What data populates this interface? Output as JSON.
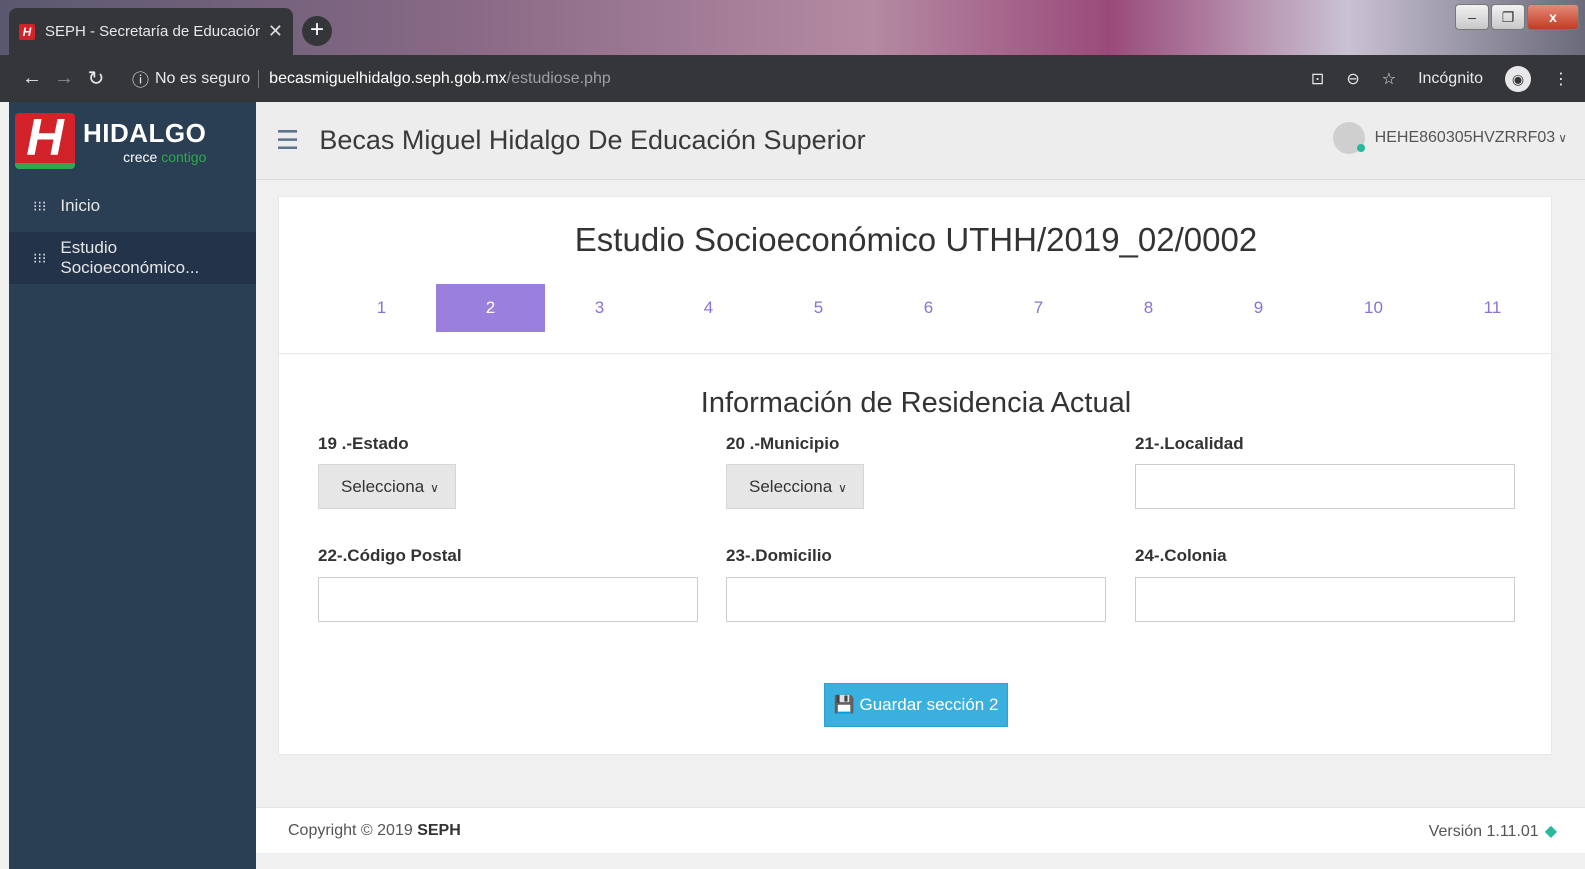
{
  "browser": {
    "tab_title": "SEPH - Secretaría de Educación P",
    "tab_favicon": "H",
    "insecure_label": "No es seguro",
    "url_host": "becasmiguelhidalgo.seph.gob.mx",
    "url_path": "/estudiose.php",
    "incognito_label": "Incógnito"
  },
  "sidebar": {
    "logo_letter": "H",
    "logo_title": "HIDALGO",
    "logo_sub_1": "crece",
    "logo_sub_2": "contigo",
    "items": [
      {
        "label": "Inicio"
      },
      {
        "label": "Estudio Socioeconómico..."
      }
    ]
  },
  "header": {
    "app_title": "Becas Miguel Hidalgo De Educación Superior",
    "user_id": "HEHE860305HVZRRF03"
  },
  "panel": {
    "title": "Estudio Socioeconómico UTHH/2019_02/0002",
    "steps": [
      "1",
      "2",
      "3",
      "4",
      "5",
      "6",
      "7",
      "8",
      "9",
      "10",
      "11"
    ],
    "active_step": "2",
    "section_title": "Información de Residencia Actual",
    "fields": {
      "estado_label": "19 .-Estado",
      "estado_value": "Selecciona",
      "municipio_label": "20 .-Municipio",
      "municipio_value": "Selecciona",
      "localidad_label": "21-.Localidad",
      "cp_label": "22-.Código Postal",
      "domicilio_label": "23-.Domicilio",
      "colonia_label": "24-.Colonia"
    },
    "save_label": "Guardar sección 2"
  },
  "footer": {
    "copyright": "Copyright © 2019",
    "copyright_brand": "SEPH",
    "version": "Versión 1.11.01"
  },
  "colors": {
    "sidebar": "#2a3f54",
    "accent_step": "#9b7fdc",
    "save_button": "#3ab0df"
  }
}
